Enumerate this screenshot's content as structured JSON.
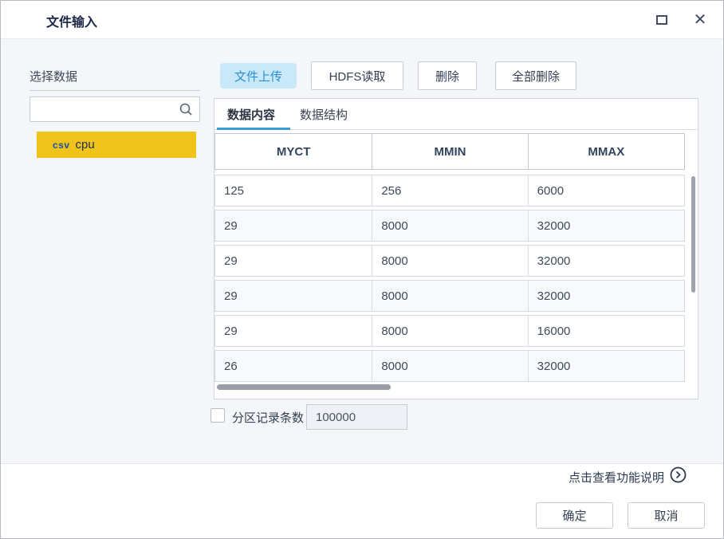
{
  "window": {
    "title": "文件输入"
  },
  "sidebar": {
    "section_label": "选择数据",
    "search": {
      "placeholder": ""
    },
    "items": [
      {
        "badge": "csv",
        "name": "cpu",
        "selected": true
      }
    ]
  },
  "toolbar": {
    "upload_label": "文件上传",
    "hdfs_label": "HDFS读取",
    "delete_label": "删除",
    "delete_all_label": "全部删除"
  },
  "tabs": {
    "content_label": "数据内容",
    "structure_label": "数据结构",
    "active": "数据内容"
  },
  "table": {
    "columns": [
      "MYCT",
      "MMIN",
      "MMAX"
    ],
    "rows": [
      [
        "125",
        "256",
        "6000"
      ],
      [
        "29",
        "8000",
        "32000"
      ],
      [
        "29",
        "8000",
        "32000"
      ],
      [
        "29",
        "8000",
        "32000"
      ],
      [
        "29",
        "8000",
        "16000"
      ],
      [
        "26",
        "8000",
        "32000"
      ]
    ]
  },
  "partition": {
    "label": "分区记录条数",
    "value": "100000",
    "checked": false
  },
  "footer": {
    "help_label": "点击查看功能说明",
    "ok_label": "确定",
    "cancel_label": "取消"
  },
  "colors": {
    "upload_bg": "#C9E8F8",
    "upload_text": "#2B8FD0",
    "selected_item_bg": "#EFC31A",
    "tab_underline": "#3E9ADA",
    "title_text": "#1B2846"
  }
}
